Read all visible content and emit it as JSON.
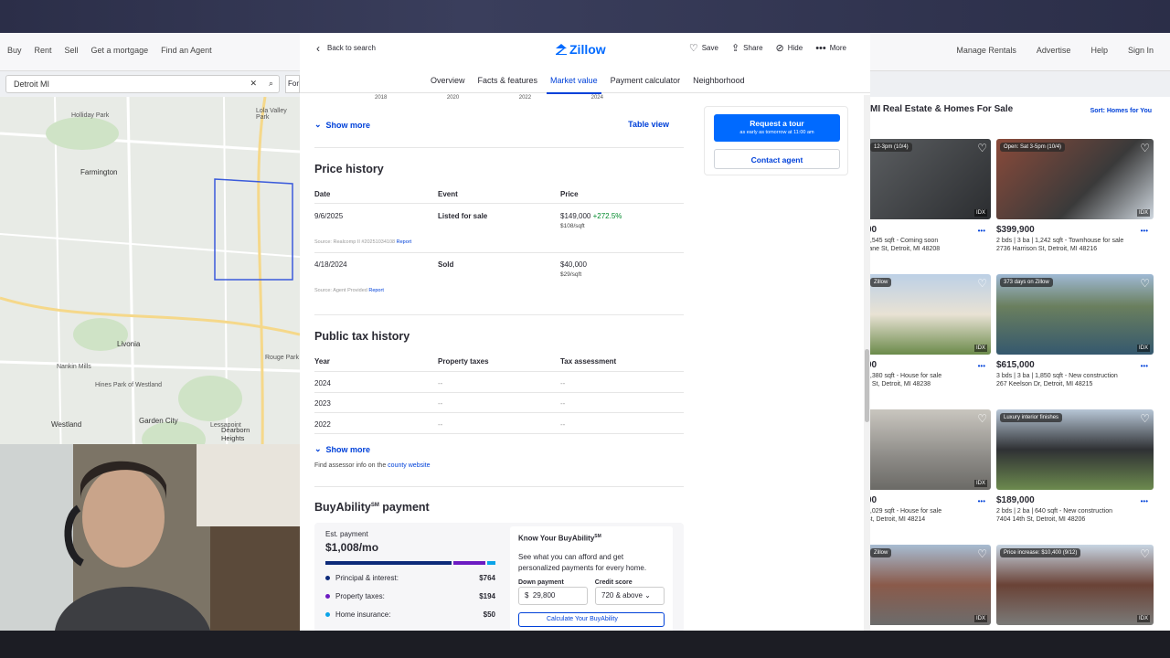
{
  "background": {
    "nav_left": [
      "Buy",
      "Rent",
      "Sell",
      "Get a mortgage",
      "Find an Agent"
    ],
    "nav_right": [
      "Manage Rentals",
      "Advertise",
      "Help",
      "Sign In"
    ],
    "search_value": "Detroit MI",
    "filter_label": "For",
    "map_labels": {
      "farmington": "Farmington",
      "livonia": "Livonia",
      "westland": "Westland",
      "garden_city": "Garden City",
      "dearborn": "Dearborn Heights",
      "rouge_park": "Rouge Park",
      "nankin_mills": "Nankin Mills",
      "holliday_park": "Holliday Park",
      "hines_park": "Hines Park of Westland",
      "lola_valley": "Lola Valley Park",
      "lesspoint": "Lessapoint"
    },
    "results_title": "MI Real Estate & Homes For Sale",
    "sort_label": "Sort: Homes for You",
    "cards": [
      {
        "badge": "12-3pm (10/4)",
        "price": "00",
        "meta": "1,545 sqft - Coming soon",
        "addr": "rane St, Detroit, MI 48208",
        "idx": "IDX"
      },
      {
        "badge": "Open: Sat 3-5pm (10/4)",
        "price": "$399,900",
        "meta": "2 bds | 3 ba | 1,242 sqft - Townhouse for sale",
        "addr": "2736 Harrison St, Detroit, MI 48216",
        "idx": "IDX"
      },
      {
        "badge": "Zillow",
        "price": "00",
        "meta": "1,380 sqft - House for sale",
        "addr": "o St, Detroit, MI 48238",
        "idx": "IDX"
      },
      {
        "badge": "373 days on Zillow",
        "price": "$615,000",
        "meta": "3 bds | 3 ba | 1,850 sqft - New construction",
        "addr": "267 Keelson Dr, Detroit, MI 48215",
        "idx": "IDX"
      },
      {
        "badge": "",
        "price": "00",
        "meta": "4,029 sqft - House for sale",
        "addr": "St, Detroit, MI 48214",
        "idx": "IDX"
      },
      {
        "badge": "Luxury interior finishes",
        "price": "$189,000",
        "meta": "2 bds | 2 ba | 640 sqft - New construction",
        "addr": "7404 14th St, Detroit, MI 48206",
        "idx": ""
      },
      {
        "badge": "Zillow",
        "price": "",
        "meta": "",
        "addr": "",
        "idx": "IDX"
      },
      {
        "badge": "Price increase: $10,400 (9/12)",
        "price": "",
        "meta": "",
        "addr": "",
        "idx": "IDX"
      }
    ]
  },
  "modal": {
    "back_label": "Back to search",
    "logo": "Zillow",
    "actions": {
      "save": "Save",
      "share": "Share",
      "hide": "Hide",
      "more": "More"
    },
    "tabs": [
      "Overview",
      "Facts & features",
      "Market value",
      "Payment calculator",
      "Neighborhood"
    ],
    "active_tab": "Market value",
    "chart_years": [
      "2018",
      "2020",
      "2022",
      "2024"
    ],
    "show_more": "Show more",
    "table_view": "Table view",
    "price_history": {
      "title": "Price history",
      "headers": [
        "Date",
        "Event",
        "Price"
      ],
      "rows": [
        {
          "date": "9/6/2025",
          "event": "Listed for sale",
          "price": "$149,000",
          "change": "+272.5%",
          "sqft": "$108/sqft",
          "source_label": "Source:",
          "source": "Realcomp II #20251034108",
          "report": "Report"
        },
        {
          "date": "4/18/2024",
          "event": "Sold",
          "price": "$40,000",
          "change": "",
          "sqft": "$29/sqft",
          "source_label": "Source:",
          "source": "Agent Provided",
          "report": "Report"
        }
      ]
    },
    "tax_history": {
      "title": "Public tax history",
      "headers": [
        "Year",
        "Property taxes",
        "Tax assessment"
      ],
      "rows": [
        {
          "year": "2024",
          "taxes": "--",
          "assessment": "--"
        },
        {
          "year": "2023",
          "taxes": "--",
          "assessment": "--"
        },
        {
          "year": "2022",
          "taxes": "--",
          "assessment": "--"
        }
      ],
      "assessor_text": "Find assessor info on the",
      "assessor_link": "county website"
    },
    "buyability": {
      "title": "BuyAbility",
      "sm": "SM",
      "title_suffix": "payment",
      "est_label": "Est. payment",
      "est_value": "$1,008/mo",
      "items": [
        {
          "label": "Principal & interest:",
          "value": "$764",
          "color": "#0d2b7a"
        },
        {
          "label": "Property taxes:",
          "value": "$194",
          "color": "#6c1bc2"
        },
        {
          "label": "Home insurance:",
          "value": "$50",
          "color": "#0aa3e8"
        }
      ],
      "know_title": "Know Your BuyAbility",
      "know_sm": "SM",
      "know_desc": "See what you can afford and get personalized payments for every home.",
      "down_label": "Down payment",
      "credit_label": "Credit score",
      "down_prefix": "$",
      "down_value": "29,800",
      "credit_value": "720 & above",
      "calc_label": "Calculate Your BuyAbility"
    },
    "side": {
      "tour_label": "Request a tour",
      "tour_sub": "as early as tomorrow at 11:00 am",
      "contact_label": "Contact agent"
    }
  },
  "colors": {
    "brand": "#006aff",
    "link": "#0041d9",
    "green": "#008a2b"
  }
}
